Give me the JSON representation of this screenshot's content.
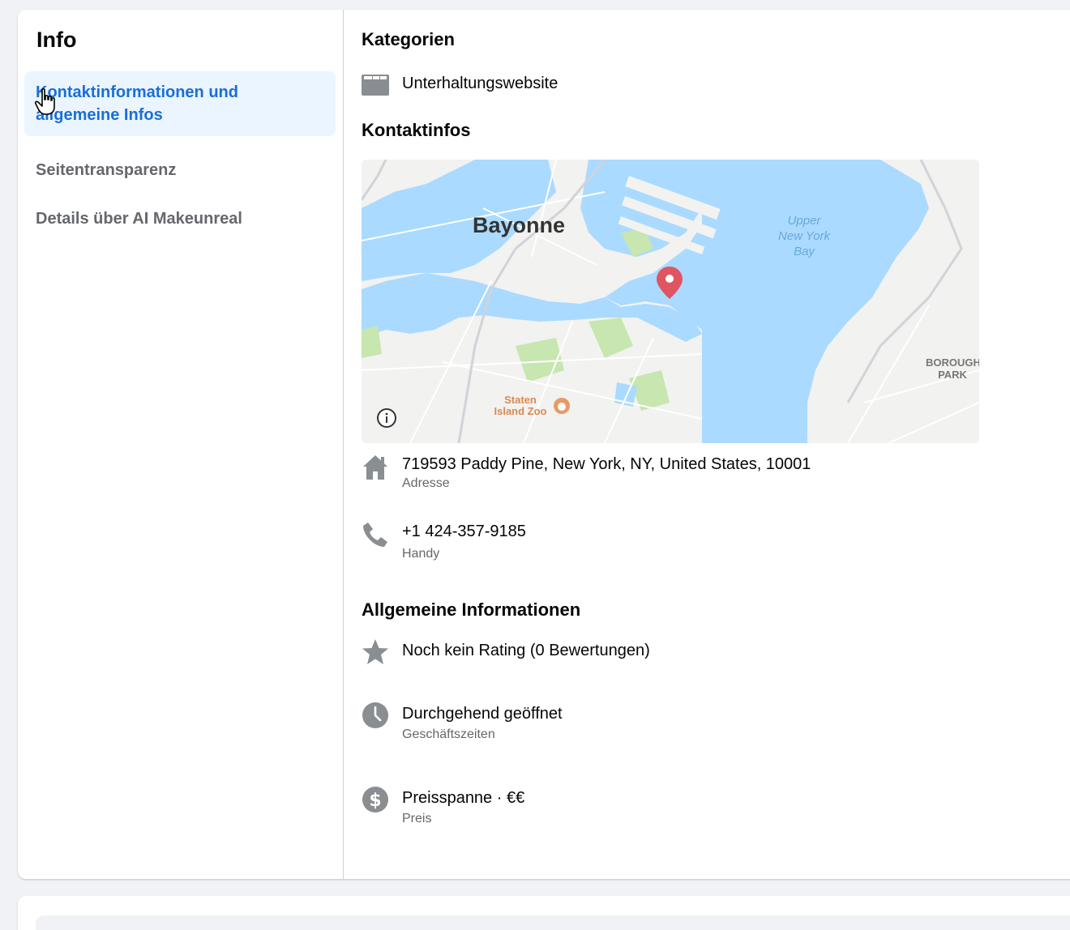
{
  "sidebar": {
    "title": "Info",
    "items": [
      {
        "label": "Kontaktinformationen und allgemeine Infos",
        "active": true
      },
      {
        "label": "Seitentransparenz",
        "active": false
      },
      {
        "label": "Details über AI Makeunreal",
        "active": false
      }
    ]
  },
  "categories": {
    "title": "Kategorien",
    "item": {
      "label": "Unterhaltungswebsite",
      "icon": "category-icon"
    }
  },
  "contact": {
    "title": "Kontaktinfos",
    "map": {
      "labels": {
        "city": "Bayonne",
        "bay": [
          "Upper",
          "New York",
          "Bay"
        ],
        "borough": [
          "BOROUGH",
          "PARK"
        ],
        "zoo": [
          "Staten",
          "Island Zoo"
        ]
      }
    },
    "address": {
      "value": "719593 Paddy Pine, New York, NY, United States, 10001",
      "label": "Adresse",
      "icon": "home-icon"
    },
    "phone": {
      "value": "+1 424-357-9185",
      "label": "Handy",
      "icon": "phone-icon"
    }
  },
  "general": {
    "title": "Allgemeine Informationen",
    "rating": {
      "value": "Noch kein Rating (0 Bewertungen)",
      "icon": "star-icon"
    },
    "hours": {
      "value": "Durchgehend geöffnet",
      "label": "Geschäftszeiten",
      "icon": "clock-icon"
    },
    "price": {
      "value": "Preisspanne · €€",
      "label": "Preis",
      "icon": "dollar-icon"
    }
  },
  "colors": {
    "accent": "#1a6ed8",
    "active_bg": "#ebf5ff",
    "water": "#aadaff",
    "land": "#f2f2f0",
    "park": "#c8e6b0",
    "pin": "#e05561",
    "icon_gray": "#8a8d91"
  }
}
